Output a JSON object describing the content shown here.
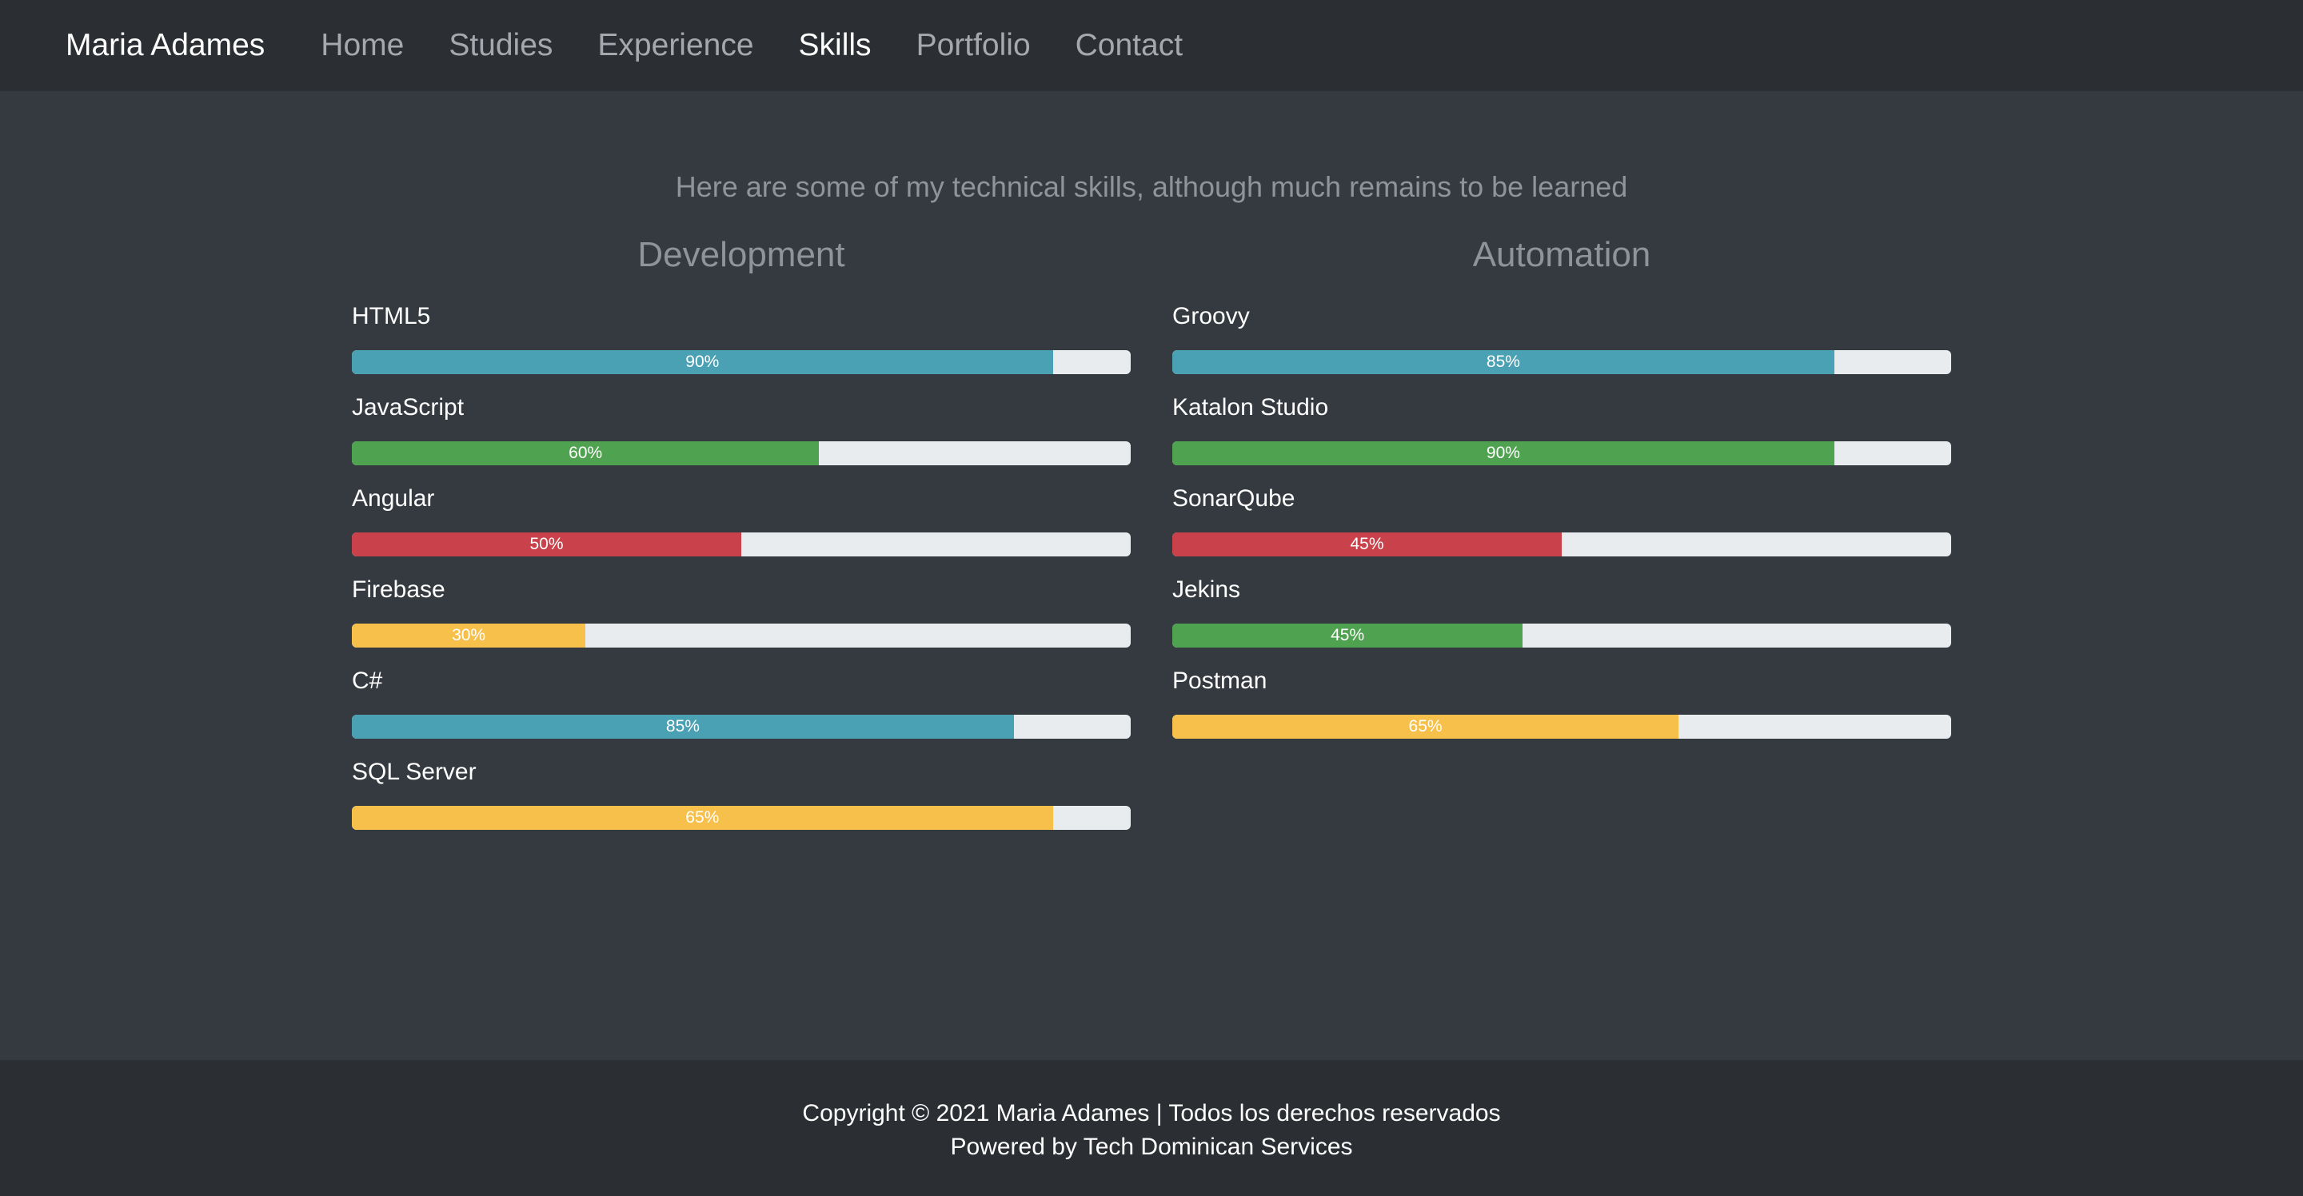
{
  "nav": {
    "brand": "Maria Adames",
    "links": [
      "Home",
      "Studies",
      "Experience",
      "Skills",
      "Portfolio",
      "Contact"
    ]
  },
  "tagline": "Here are some of my technical skills, although much remains to be learned",
  "columns": [
    {
      "title": "Development",
      "skills": [
        {
          "name": "HTML5",
          "label": "90%",
          "fill": 0.9,
          "color": "#4aa1b3"
        },
        {
          "name": "JavaScript",
          "label": "60%",
          "fill": 0.6,
          "color": "#4fa24f"
        },
        {
          "name": "Angular",
          "label": "50%",
          "fill": 0.5,
          "color": "#c9414a"
        },
        {
          "name": "Firebase",
          "label": "30%",
          "fill": 0.3,
          "color": "#f7c04a"
        },
        {
          "name": "C#",
          "label": "85%",
          "fill": 0.85,
          "color": "#4aa1b3"
        },
        {
          "name": "SQL Server",
          "label": "65%",
          "fill": 0.9,
          "color": "#f7c04a"
        }
      ]
    },
    {
      "title": "Automation",
      "skills": [
        {
          "name": "Groovy",
          "label": "85%",
          "fill": 0.85,
          "color": "#4aa1b3"
        },
        {
          "name": "Katalon Studio",
          "label": "90%",
          "fill": 0.85,
          "color": "#4fa24f"
        },
        {
          "name": "SonarQube",
          "label": "45%",
          "fill": 0.5,
          "color": "#c9414a"
        },
        {
          "name": "Jekins",
          "label": "45%",
          "fill": 0.45,
          "color": "#4fa24f"
        },
        {
          "name": "Postman",
          "label": "65%",
          "fill": 0.65,
          "color": "#f7c04a"
        }
      ]
    }
  ],
  "footer": {
    "line1": "Copyright © 2021 Maria Adames | Todos los derechos reservados",
    "line2": "Powered by Tech Dominican Services"
  }
}
